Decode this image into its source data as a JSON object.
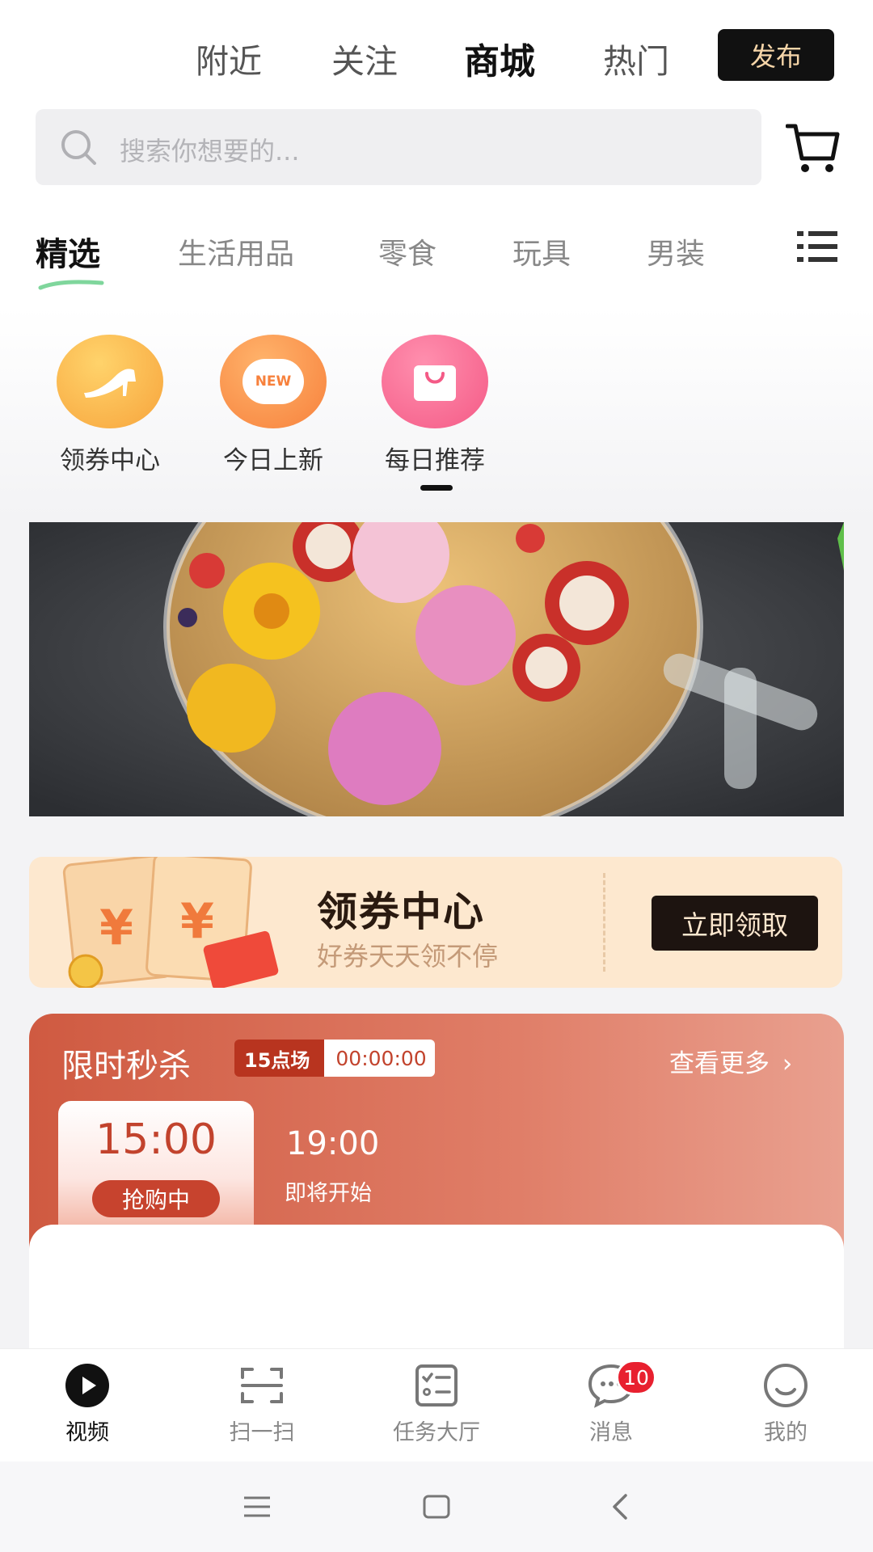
{
  "top_tabs": [
    {
      "label": "附近",
      "active": false
    },
    {
      "label": "关注",
      "active": false
    },
    {
      "label": "商城",
      "active": true
    },
    {
      "label": "热门",
      "active": false
    }
  ],
  "publish_label": "发布",
  "search": {
    "placeholder": "搜索你想要的..."
  },
  "categories": [
    {
      "label": "精选",
      "active": true
    },
    {
      "label": "生活用品",
      "active": false
    },
    {
      "label": "零食",
      "active": false
    },
    {
      "label": "玩具",
      "active": false
    },
    {
      "label": "男装",
      "active": false
    }
  ],
  "quick_entries": [
    {
      "label": "领券中心",
      "icon": "high-heel-icon"
    },
    {
      "label": "今日上新",
      "icon": "new-badge-icon",
      "icon_text": "NEW"
    },
    {
      "label": "每日推荐",
      "icon": "shopping-bag-icon"
    }
  ],
  "banner": {
    "subject": "flower-tea-teapot"
  },
  "coupon_center": {
    "title": "领券中心",
    "subtitle": "好券天天领不停",
    "button": "立即领取",
    "yen_symbol": "¥"
  },
  "flash_sale": {
    "title": "限时秒杀",
    "session_label": "15点场",
    "countdown": "00:00:00",
    "more_label": "查看更多",
    "slots": [
      {
        "time": "15:00",
        "status": "抢购中",
        "active": true
      },
      {
        "time": "19:00",
        "status": "即将开始",
        "active": false
      }
    ]
  },
  "bottom_nav": [
    {
      "label": "视频",
      "icon": "play-icon",
      "active": true
    },
    {
      "label": "扫一扫",
      "icon": "scan-icon",
      "active": false
    },
    {
      "label": "任务大厅",
      "icon": "task-list-icon",
      "active": false
    },
    {
      "label": "消息",
      "icon": "chat-icon",
      "active": false,
      "badge": "10"
    },
    {
      "label": "我的",
      "icon": "smiley-icon",
      "active": false
    }
  ],
  "colors": {
    "accent": "#cf5a41",
    "coupon_bg": "#fde8cf",
    "badge": "#e8202f"
  }
}
